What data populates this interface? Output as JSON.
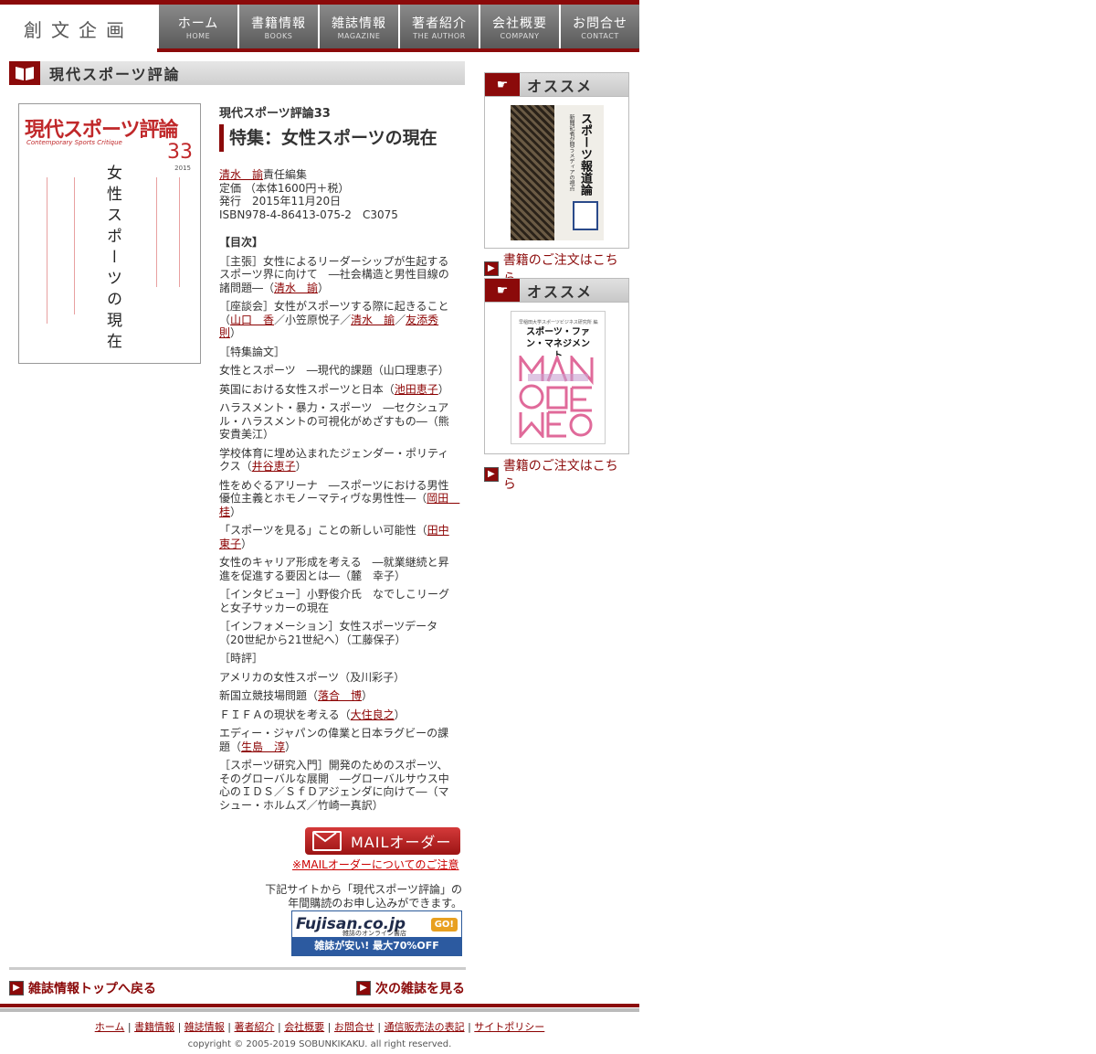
{
  "header": {
    "logo": "創文企画",
    "nav": [
      {
        "ja": "ホーム",
        "en": "HOME"
      },
      {
        "ja": "書籍情報",
        "en": "BOOKS"
      },
      {
        "ja": "雑誌情報",
        "en": "MAGAZINE"
      },
      {
        "ja": "著者紹介",
        "en": "THE AUTHOR"
      },
      {
        "ja": "会社概要",
        "en": "COMPANY"
      },
      {
        "ja": "お問合せ",
        "en": "CONTACT"
      }
    ]
  },
  "section_title": "現代スポーツ評論",
  "cover": {
    "title": "現代スポーツ評論",
    "subtitle": "Contemporary Sports Critique",
    "number": "33",
    "year": "2015",
    "vertical_title": "女性スポーツの現在"
  },
  "magazine": {
    "series": "現代スポーツ評論33",
    "feature": "特集：女性スポーツの現在",
    "editor_name": "清水　諭",
    "editor_role": "責任編集",
    "price": "定価 （本体1600円＋税）",
    "issued": "発行　2015年11月20日",
    "isbn": "ISBN978-4-86413-075-2　C3075"
  },
  "toc": {
    "heading": "【目次】",
    "items": [
      {
        "pre": "［主張］女性によるリーダーシップが生起するスポーツ界に向けて　―社会構造と男性目線の諸問題―（",
        "link": "清水　諭",
        "post": "）"
      },
      {
        "pre": "［座談会］女性がスポーツする際に起きること（",
        "links": [
          "山口　香",
          "小笠原悦子",
          "清水　諭",
          "友添秀則"
        ],
        "post": "）"
      },
      {
        "pre": "［特集論文］",
        "link": "",
        "post": ""
      },
      {
        "pre": "女性とスポーツ　―現代的課題（山口理恵子）",
        "link": "",
        "post": ""
      },
      {
        "pre": "英国における女性スポーツと日本（",
        "link": "池田恵子",
        "post": "）"
      },
      {
        "pre": "ハラスメント・暴力・スポーツ　―セクシュアル・ハラスメントの可視化がめざすもの―（熊安貴美江）",
        "link": "",
        "post": ""
      },
      {
        "pre": "学校体育に埋め込まれたジェンダー・ポリティクス（",
        "link": "井谷恵子",
        "post": "）"
      },
      {
        "pre": "性をめぐるアリーナ　―スポーツにおける男性優位主義とホモノーマティヴな男性性―（",
        "link": "岡田　桂",
        "post": "）"
      },
      {
        "pre": "「スポーツを見る」ことの新しい可能性（",
        "link": "田中東子",
        "post": "）"
      },
      {
        "pre": "女性のキャリア形成を考える　―就業継続と昇進を促進する要因とは―（麓　幸子）",
        "link": "",
        "post": ""
      },
      {
        "pre": "［インタビュー］小野俊介氏　なでしこリーグと女子サッカーの現在",
        "link": "",
        "post": ""
      },
      {
        "pre": "［インフォメーション］女性スポーツデータ（20世紀から21世紀へ）（工藤保子）",
        "link": "",
        "post": ""
      },
      {
        "pre": "［時評］",
        "link": "",
        "post": ""
      },
      {
        "pre": "アメリカの女性スポーツ（及川彩子）",
        "link": "",
        "post": ""
      },
      {
        "pre": "新国立競技場問題（",
        "link": "落合　博",
        "post": "）"
      },
      {
        "pre": "ＦＩＦＡの現状を考える（",
        "link": "大住良之",
        "post": "）"
      },
      {
        "pre": "エディー・ジャパンの偉業と日本ラグビーの課題（",
        "link": "生島　淳",
        "post": "）"
      },
      {
        "pre": "［スポーツ研究入門］開発のためのスポーツ、そのグローバルな展開　―グローバルサウス中心のＩＤＳ／ＳｆＤアジェンダに向けて―（マシュー・ホルムズ／竹崎一真訳）",
        "link": "",
        "post": ""
      }
    ]
  },
  "mail": {
    "button": "MAILオーダー",
    "note": "※MAILオーダーについてのご注意"
  },
  "subscribe": {
    "text1": "下記サイトから「現代スポーツ評論」の",
    "text2": "年間購読のお申し込みができます。",
    "fujisan_logo": "Fujisan.co.jp",
    "fujisan_go": "GO!",
    "fujisan_small": "雑誌のオンライン書店",
    "fujisan_banner": "雑誌が安い! 最大70%OFF"
  },
  "bottom_nav": {
    "back": "雑誌情報トップへ戻る",
    "next": "次の雑誌を見る"
  },
  "footer": {
    "links": [
      "ホーム",
      "書籍情報",
      "雑誌情報",
      "著者紹介",
      "会社概要",
      "お問合せ",
      "通信販売法の表記",
      "サイトポリシー"
    ],
    "copyright": "copyright © 2005-2019 SOBUNKIKAKU. all right reserved."
  },
  "sidebar": {
    "label": "オススメ",
    "order": "書籍のご注文はこちら",
    "book1_title": "スポーツ報道論",
    "book1_sub": "新聞記者が問うメディアの視点",
    "book2_top": "早稲田大学スポーツビジネス研究所 編",
    "book2_title": "スポーツ・ファン・マネジメント"
  }
}
